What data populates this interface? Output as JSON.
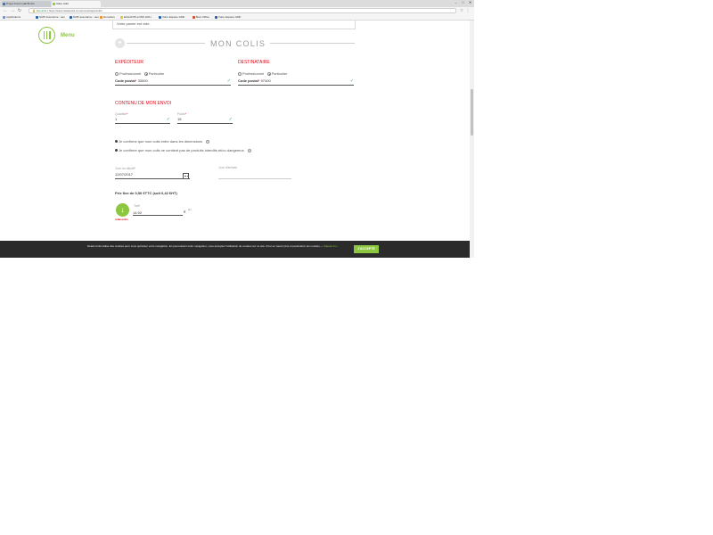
{
  "browser": {
    "tabs": [
      {
        "label": "Projet Intermodal Bi-Mo"
      },
      {
        "label": "Votre colis"
      }
    ],
    "window_controls": [
      "–",
      "□",
      "✕"
    ],
    "address": {
      "secure_label": "Sécurisé",
      "url": "https://www.relaiscolis.com/envoi/etape/colis/"
    },
    "bookmarks": [
      {
        "label": "Applications",
        "icon": "apps-icon"
      },
      {
        "label": "GMF Assurance : asu",
        "icon": "gmf-icon"
      },
      {
        "label": "GMF assurance : asu",
        "icon": "gmf-icon"
      },
      {
        "label": "Homebox",
        "icon": "homebox-icon"
      },
      {
        "label": "ECHANTILLONS HOH",
        "icon": "folder-icon"
      },
      {
        "label": "Votre Espace GMF",
        "icon": "gmf-icon"
      },
      {
        "label": "Buro Office",
        "icon": "office-icon"
      },
      {
        "label": "Votre Espace GMF",
        "icon": "gmf-icon"
      }
    ]
  },
  "menu": {
    "label": "Menu"
  },
  "summary": {
    "text": "Votre panier est vide."
  },
  "section": {
    "title": "MON COLIS"
  },
  "expediteur": {
    "heading": "EXPÉDITEUR",
    "options": [
      "Professionnel",
      "Particulier"
    ],
    "postal_label": "Code postal",
    "postal_value": "33000"
  },
  "destinataire": {
    "heading": "DESTINATAIRE",
    "options": [
      "Professionnel",
      "Particulier"
    ],
    "postal_label": "Code postal",
    "postal_value": "97400"
  },
  "contenu": {
    "heading": "CONTENU DE MON ENVOI",
    "quantity_label": "Quantité",
    "quantity_value": "1",
    "weight_label": "Poids",
    "weight_value": "15"
  },
  "acknowledgements": [
    "Je confirme que mon colis entre dans les dimensions",
    "Je confirme que mon colis ne contient pas de produits interdits et/ou dangereux"
  ],
  "dates": {
    "depot_label": "Jour du dépôt",
    "depot_value": "12/07/2017",
    "alt_label": "Jour d'arrivée"
  },
  "pricing": {
    "price_line": "Prix fixe de 0,50 €TTC (soit 0,42 €HT)",
    "tarif_label": "Tarif",
    "tarif_value": "14.92",
    "currency": "€",
    "currency_note": "(1)",
    "logo_text": "relaiscolis"
  },
  "cookie": {
    "text": "Relais Colis utilise des cookies pour vous optimiser votre navigation. En poursuivant votre navigation, vous acceptez l'utilisation de cookies sur ce site. Pour en savoir plus et paramétrer les cookies,",
    "more": "« Cliquez ici »",
    "button": "J'ACCEPTE"
  },
  "colors": {
    "accent": "#8dc63f",
    "brand_red": "#e30613",
    "banner": "#2b2b2b"
  }
}
